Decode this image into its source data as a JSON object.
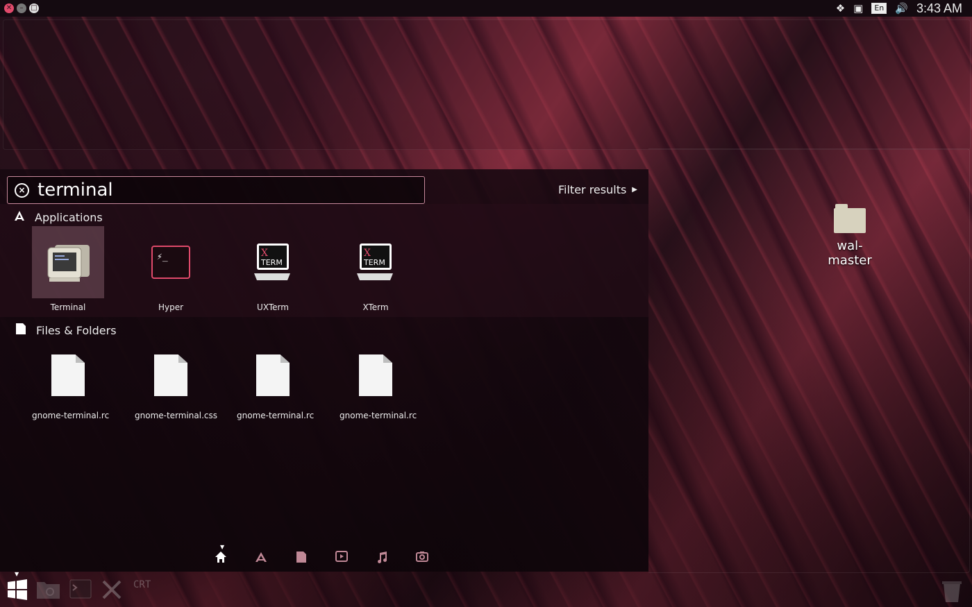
{
  "topbar": {
    "clock": "3:43 AM",
    "language": "En"
  },
  "search": {
    "query": "terminal",
    "filter_label": "Filter results"
  },
  "categories": {
    "applications": "Applications",
    "files": "Files & Folders"
  },
  "apps": [
    {
      "label": "Terminal"
    },
    {
      "label": "Hyper"
    },
    {
      "label": "UXTerm"
    },
    {
      "label": "XTerm"
    }
  ],
  "files": [
    {
      "label": "gnome-terminal.rc"
    },
    {
      "label": "gnome-terminal.css"
    },
    {
      "label": "gnome-terminal.rc"
    },
    {
      "label": "gnome-terminal.rc"
    }
  ],
  "desktop": {
    "folder_label": "wal-master"
  },
  "icons": {
    "xterm_text_x": "X",
    "xterm_text_term": "TERM",
    "hyper_prompt": "⚡_",
    "crt_text": "CRT"
  },
  "colors": {
    "accent": "#e04a6b",
    "search_border": "#c98a9d",
    "lens_inactive": "#c08896"
  }
}
